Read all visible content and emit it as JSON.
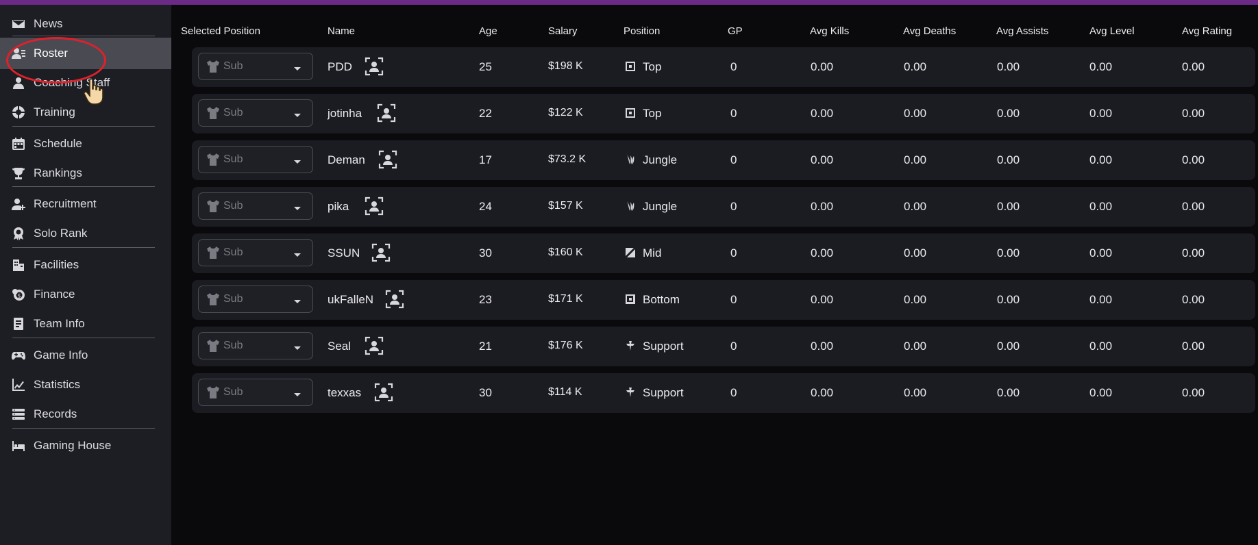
{
  "sidebar": {
    "items": [
      {
        "label": "News",
        "icon": "mail-icon",
        "active": false
      },
      {
        "label": "Roster",
        "icon": "roster-icon",
        "active": true
      },
      {
        "label": "Coaching Staff",
        "icon": "coach-icon",
        "active": false
      },
      {
        "label": "Training",
        "icon": "training-icon",
        "active": false
      },
      {
        "label": "Schedule",
        "icon": "calendar-icon",
        "active": false
      },
      {
        "label": "Rankings",
        "icon": "trophy-icon",
        "active": false
      },
      {
        "label": "Recruitment",
        "icon": "recruit-icon",
        "active": false
      },
      {
        "label": "Solo Rank",
        "icon": "medal-icon",
        "active": false
      },
      {
        "label": "Facilities",
        "icon": "building-icon",
        "active": false
      },
      {
        "label": "Finance",
        "icon": "coins-icon",
        "active": false
      },
      {
        "label": "Team Info",
        "icon": "document-icon",
        "active": false
      },
      {
        "label": "Game Info",
        "icon": "gamepad-icon",
        "active": false
      },
      {
        "label": "Statistics",
        "icon": "chart-icon",
        "active": false
      },
      {
        "label": "Records",
        "icon": "list-icon",
        "active": false
      },
      {
        "label": "Gaming House",
        "icon": "bed-icon",
        "active": false
      }
    ]
  },
  "table": {
    "headers": {
      "selected_position": "Selected Position",
      "name": "Name",
      "age": "Age",
      "salary": "Salary",
      "position": "Position",
      "gp": "GP",
      "avg_kills": "Avg Kills",
      "avg_deaths": "Avg Deaths",
      "avg_assists": "Avg Assists",
      "avg_level": "Avg Level",
      "avg_rating": "Avg Rating"
    },
    "rows": [
      {
        "selected": "Sub",
        "name": "PDD",
        "age": "25",
        "salary": "$198 K",
        "position": "Top",
        "role_icon": "top-lane-icon",
        "gp": "0",
        "avg_kills": "0.00",
        "avg_deaths": "0.00",
        "avg_assists": "0.00",
        "avg_level": "0.00",
        "avg_rating": "0.00"
      },
      {
        "selected": "Sub",
        "name": "jotinha",
        "age": "22",
        "salary": "$122 K",
        "position": "Top",
        "role_icon": "top-lane-icon",
        "gp": "0",
        "avg_kills": "0.00",
        "avg_deaths": "0.00",
        "avg_assists": "0.00",
        "avg_level": "0.00",
        "avg_rating": "0.00"
      },
      {
        "selected": "Sub",
        "name": "Deman",
        "age": "17",
        "salary": "$73.2 K",
        "position": "Jungle",
        "role_icon": "jungle-icon",
        "gp": "0",
        "avg_kills": "0.00",
        "avg_deaths": "0.00",
        "avg_assists": "0.00",
        "avg_level": "0.00",
        "avg_rating": "0.00"
      },
      {
        "selected": "Sub",
        "name": "pika",
        "age": "24",
        "salary": "$157 K",
        "position": "Jungle",
        "role_icon": "jungle-icon",
        "gp": "0",
        "avg_kills": "0.00",
        "avg_deaths": "0.00",
        "avg_assists": "0.00",
        "avg_level": "0.00",
        "avg_rating": "0.00"
      },
      {
        "selected": "Sub",
        "name": "SSUN",
        "age": "30",
        "salary": "$160 K",
        "position": "Mid",
        "role_icon": "mid-lane-icon",
        "gp": "0",
        "avg_kills": "0.00",
        "avg_deaths": "0.00",
        "avg_assists": "0.00",
        "avg_level": "0.00",
        "avg_rating": "0.00"
      },
      {
        "selected": "Sub",
        "name": "ukFalleN",
        "age": "23",
        "salary": "$171 K",
        "position": "Bottom",
        "role_icon": "bottom-lane-icon",
        "gp": "0",
        "avg_kills": "0.00",
        "avg_deaths": "0.00",
        "avg_assists": "0.00",
        "avg_level": "0.00",
        "avg_rating": "0.00"
      },
      {
        "selected": "Sub",
        "name": "Seal",
        "age": "21",
        "salary": "$176 K",
        "position": "Support",
        "role_icon": "support-icon",
        "gp": "0",
        "avg_kills": "0.00",
        "avg_deaths": "0.00",
        "avg_assists": "0.00",
        "avg_level": "0.00",
        "avg_rating": "0.00"
      },
      {
        "selected": "Sub",
        "name": "texxas",
        "age": "30",
        "salary": "$114 K",
        "position": "Support",
        "role_icon": "support-icon",
        "gp": "0",
        "avg_kills": "0.00",
        "avg_deaths": "0.00",
        "avg_assists": "0.00",
        "avg_level": "0.00",
        "avg_rating": "0.00"
      }
    ]
  },
  "colors": {
    "accent_bar": "#6a2a86",
    "highlight_ring": "#e0202a",
    "sidebar_bg": "#1d1e24",
    "row_bg": "#1b1c22"
  }
}
